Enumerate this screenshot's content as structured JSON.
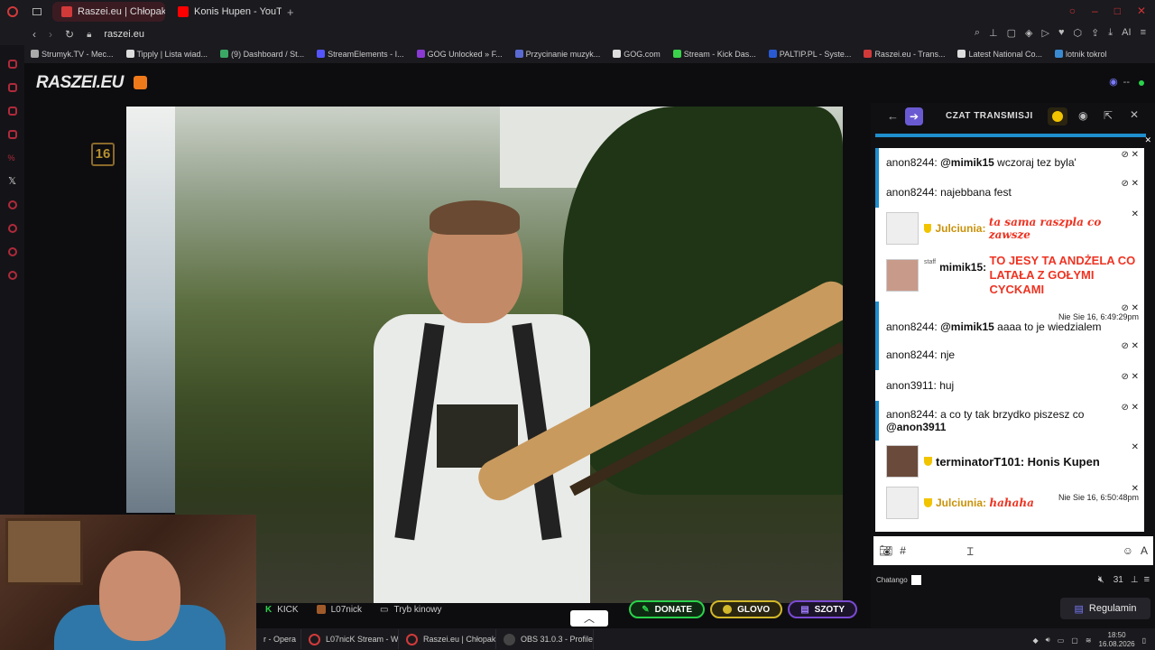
{
  "browser": {
    "tabs": [
      {
        "label": "Raszei.eu | Chłopaki z",
        "active": true,
        "color": "#d23a3a"
      },
      {
        "label": "Konis Hupen - YouTube",
        "active": false,
        "color": "#ff0000"
      }
    ],
    "url": "raszei.eu",
    "bookmarks": [
      "Strumyk.TV - Mec...",
      "Tipply | Lista wiad...",
      "(9) Dashboard / St...",
      "StreamElements - I...",
      "GOG Unlocked » F...",
      "Przycinanie muzyk...",
      "GOG.com",
      "Stream - Kick Das...",
      "PALTIP.PL - Syste...",
      "Raszei.eu - Trans...",
      "Latest National Co...",
      "lotnik tokrol"
    ]
  },
  "site": {
    "logo": "RASZEI.EU",
    "viewer_count": "--",
    "age_badge": "16"
  },
  "player_bar": {
    "kick": "KICK",
    "user": "L07nick",
    "theater": "Tryb kinowy",
    "donate": "DONATE",
    "glovo": "GLOVO",
    "szoty": "SZOTY"
  },
  "chat": {
    "title": "CZAT TRANSMISJI",
    "messages": [
      {
        "user": "anon8244:",
        "text": "@mimik15 wczoraj tez byla'",
        "mention": "@mimik15",
        "rest": " wczoraj tez byla'"
      },
      {
        "user": "anon8244:",
        "text": "najebbana fest"
      },
      {
        "user": "Julciunia:",
        "text": "ta sama raszpla co zawsze"
      },
      {
        "user": "mimik15:",
        "text": "TO JESY TA ANDŻELA CO LATAŁA Z GOŁYMI CYCKAMI",
        "staff": "staff"
      },
      {
        "user": "anon8244:",
        "mention": "@mimik15",
        "rest": " aaaa to je wiedzialem",
        "time": "Nie Sie 16, 6:49:29pm"
      },
      {
        "user": "anon8244:",
        "text": "nje"
      },
      {
        "user": "anon3911:",
        "text": "huj"
      },
      {
        "user": "anon8244:",
        "text": "a co ty tak brzydko piszesz co",
        "mention": "@anon3911"
      },
      {
        "user": "terminatorT101:",
        "text": "Honis Kupen"
      },
      {
        "user": "Julciunia:",
        "text": "hahaha",
        "time": "Nie Sie 16, 6:50:48pm"
      }
    ],
    "input_prefix": "#",
    "footer_brand": "Chatango",
    "footer_count": "31",
    "register": "Regulamin"
  },
  "taskbar": {
    "items": [
      {
        "label": "r - Opera",
        "color": "#d23a3a"
      },
      {
        "label": "L07nicK Stream - W...",
        "color": "#d23a3a"
      },
      {
        "label": "Raszei.eu | Chłopak...",
        "color": "#d23a3a"
      },
      {
        "label": "OBS 31.0.3 - Profile:...",
        "color": "#333333"
      }
    ],
    "time": "18:50",
    "date": "16.08.2026"
  }
}
